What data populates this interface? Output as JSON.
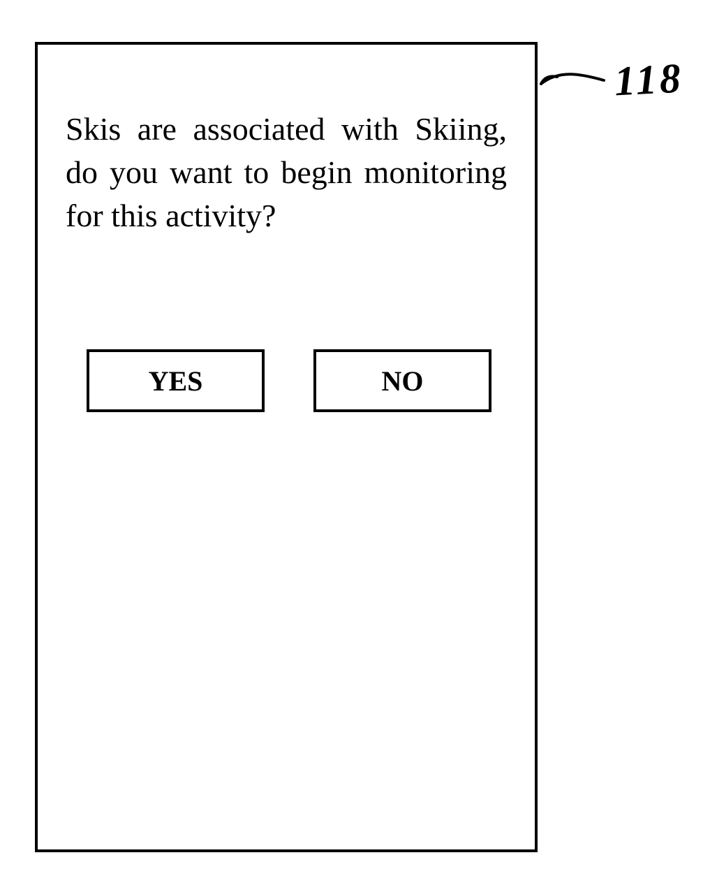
{
  "dialog": {
    "prompt": "Skis are associated with Skiing, do you want to begin monitoring for this activity?",
    "buttons": {
      "yes": "YES",
      "no": "NO"
    }
  },
  "annotation": {
    "figure_ref": "118"
  }
}
